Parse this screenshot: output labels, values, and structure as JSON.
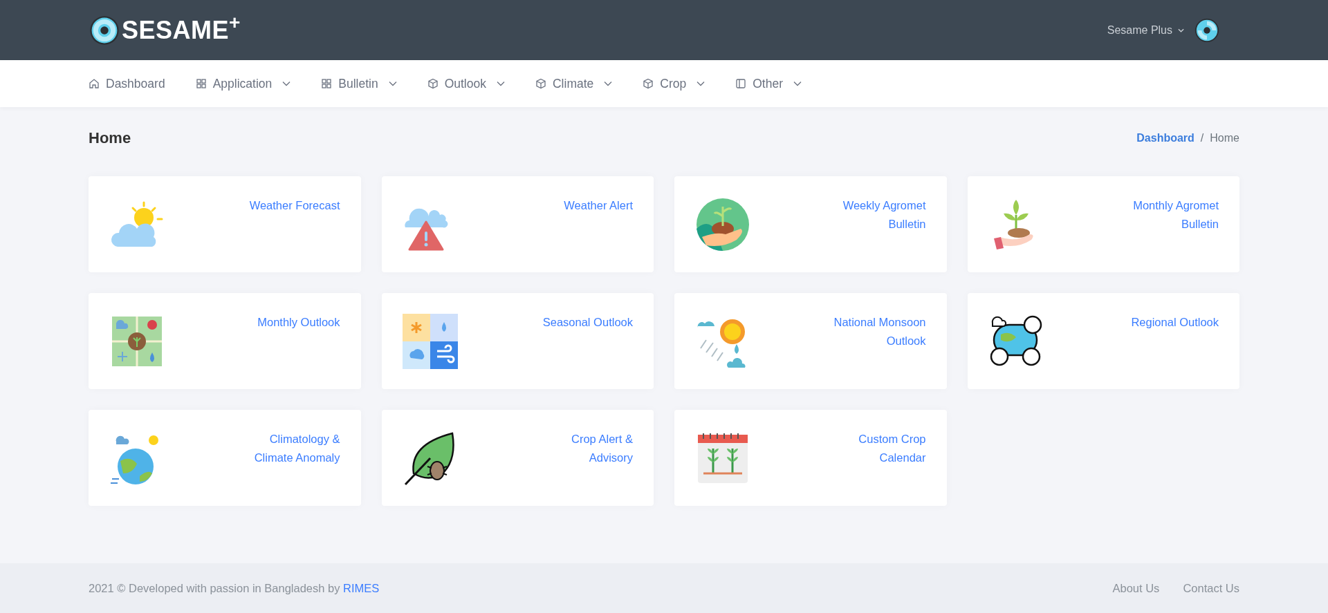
{
  "header": {
    "logo": "SESAME$^{+}$",
    "user_menu": "Sesame Plus"
  },
  "nav": [
    {
      "label": "Dashboard",
      "kind": "home",
      "dropdown": false
    },
    {
      "label": "Application",
      "kind": "grid",
      "dropdown": true
    },
    {
      "label": "Bulletin",
      "kind": "grid",
      "dropdown": true
    },
    {
      "label": "Outlook",
      "kind": "cube",
      "dropdown": true
    },
    {
      "label": "Climate",
      "kind": "cube",
      "dropdown": true
    },
    {
      "label": "Crop",
      "kind": "cube",
      "dropdown": true
    },
    {
      "label": "Other",
      "kind": "panel",
      "dropdown": true
    }
  ],
  "page": {
    "title": "Home",
    "breadcrumb_separator": "/",
    "breadcrumb": [
      {
        "label": "Dashboard",
        "link": true
      },
      {
        "label": "Home",
        "link": false
      }
    ]
  },
  "cards": [
    {
      "title": "Weather Forecast",
      "kind": "sun-cloud"
    },
    {
      "title": "Weather Alert",
      "kind": "cloud-alert"
    },
    {
      "title": "Weekly Agromet\nBulletin",
      "kind": "globe-plant"
    },
    {
      "title": "Monthly Agromet\nBulletin",
      "kind": "hand-plant"
    },
    {
      "title": "Monthly Outlook",
      "kind": "map-grid"
    },
    {
      "title": "Seasonal Outlook",
      "kind": "season-grid"
    },
    {
      "title": "National Monsoon\nOutlook",
      "kind": "sun-rain"
    },
    {
      "title": "Regional Outlook",
      "kind": "globe-weather"
    },
    {
      "title": "Climatology &\nClimate Anomaly",
      "kind": "earth-climate"
    },
    {
      "title": "Crop Alert &\nAdvisory",
      "kind": "leaf-bug"
    },
    {
      "title": "Custom Crop\nCalendar",
      "kind": "calendar"
    }
  ],
  "footer": {
    "text": "2021 © Developed with passion in Bangladesh by",
    "link": "RIMES",
    "links": [
      "About Us",
      "Contact Us"
    ]
  }
}
